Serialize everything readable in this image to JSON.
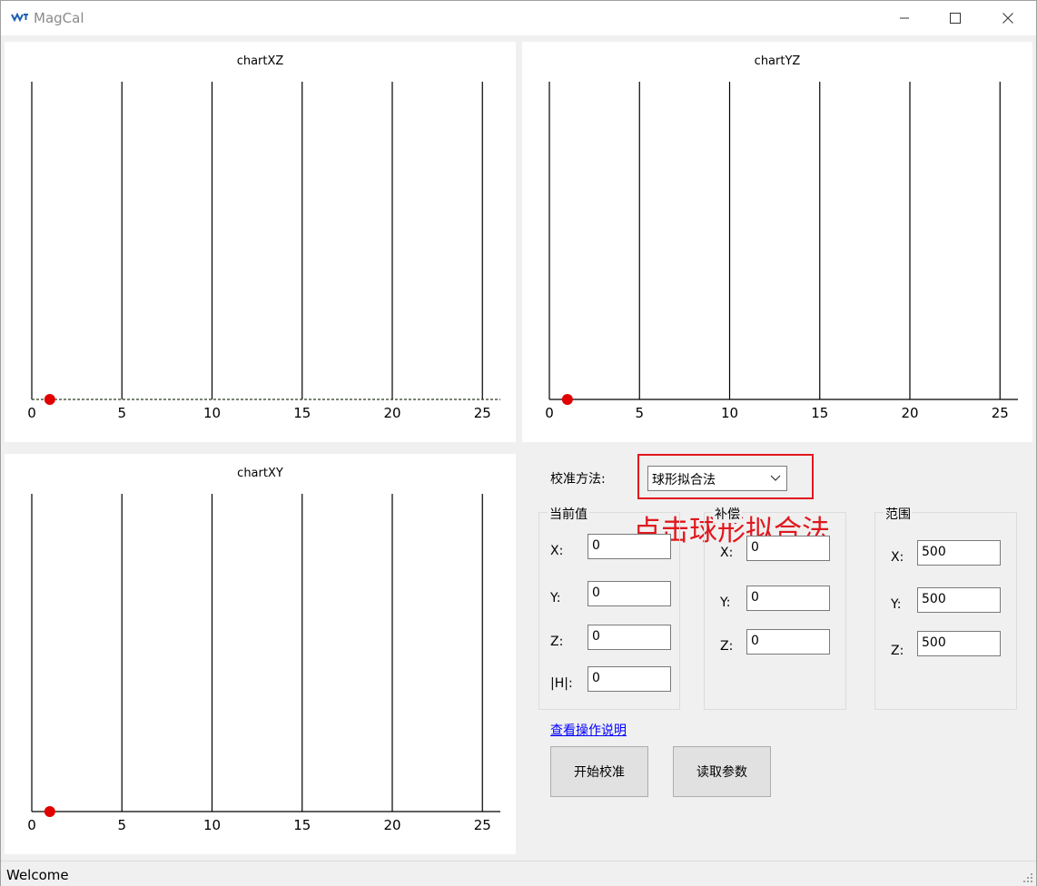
{
  "window": {
    "title": "MagCal",
    "icon": "app-logo-icon",
    "controls": [
      "minimize-icon",
      "maximize-icon",
      "close-icon"
    ]
  },
  "charts": {
    "xz": {
      "title": "chartXZ",
      "chart_data": {
        "type": "scatter",
        "title": "chartXZ",
        "xlim": [
          0,
          26
        ],
        "x_ticks": [
          "0",
          "5",
          "10",
          "15",
          "20",
          "25"
        ],
        "grid": "vertical",
        "series": [
          {
            "points": [
              [
                1,
                0
              ]
            ],
            "color": "#e00000"
          }
        ],
        "baseline": "dashed"
      }
    },
    "yz": {
      "title": "chartYZ",
      "chart_data": {
        "type": "scatter",
        "title": "chartYZ",
        "xlim": [
          0,
          26
        ],
        "x_ticks": [
          "0",
          "5",
          "10",
          "15",
          "20",
          "25"
        ],
        "grid": "vertical",
        "series": [
          {
            "points": [
              [
                1,
                0
              ]
            ],
            "color": "#e00000"
          }
        ],
        "baseline": "solid"
      }
    },
    "xy": {
      "title": "chartXY",
      "chart_data": {
        "type": "scatter",
        "title": "chartXY",
        "xlim": [
          0,
          26
        ],
        "x_ticks": [
          "0",
          "5",
          "10",
          "15",
          "20",
          "25"
        ],
        "grid": "vertical",
        "series": [
          {
            "points": [
              [
                1,
                0
              ]
            ],
            "color": "#e00000"
          }
        ],
        "baseline": "solid"
      }
    }
  },
  "calibration": {
    "method_label": "校准方法:",
    "method_value": "球形拟合法",
    "annotation": "点击球形拟合法",
    "annotation_color": "#e0181e"
  },
  "current": {
    "title": "当前值",
    "x_label": "X:",
    "x_value": "0",
    "y_label": "Y:",
    "y_value": "0",
    "z_label": "Z:",
    "z_value": "0",
    "h_label": "|H|:",
    "h_value": "0"
  },
  "compensation": {
    "title": "补偿",
    "x_label": "X:",
    "x_value": "0",
    "y_label": "Y:",
    "y_value": "0",
    "z_label": "Z:",
    "z_value": "0"
  },
  "range": {
    "title": "范围",
    "x_label": "X:",
    "x_value": "500",
    "y_label": "Y:",
    "y_value": "500",
    "z_label": "Z:",
    "z_value": "500"
  },
  "help_link": "查看操作说明",
  "buttons": {
    "start": "开始校准",
    "read": "读取参数"
  },
  "status": {
    "text": "Welcome"
  }
}
